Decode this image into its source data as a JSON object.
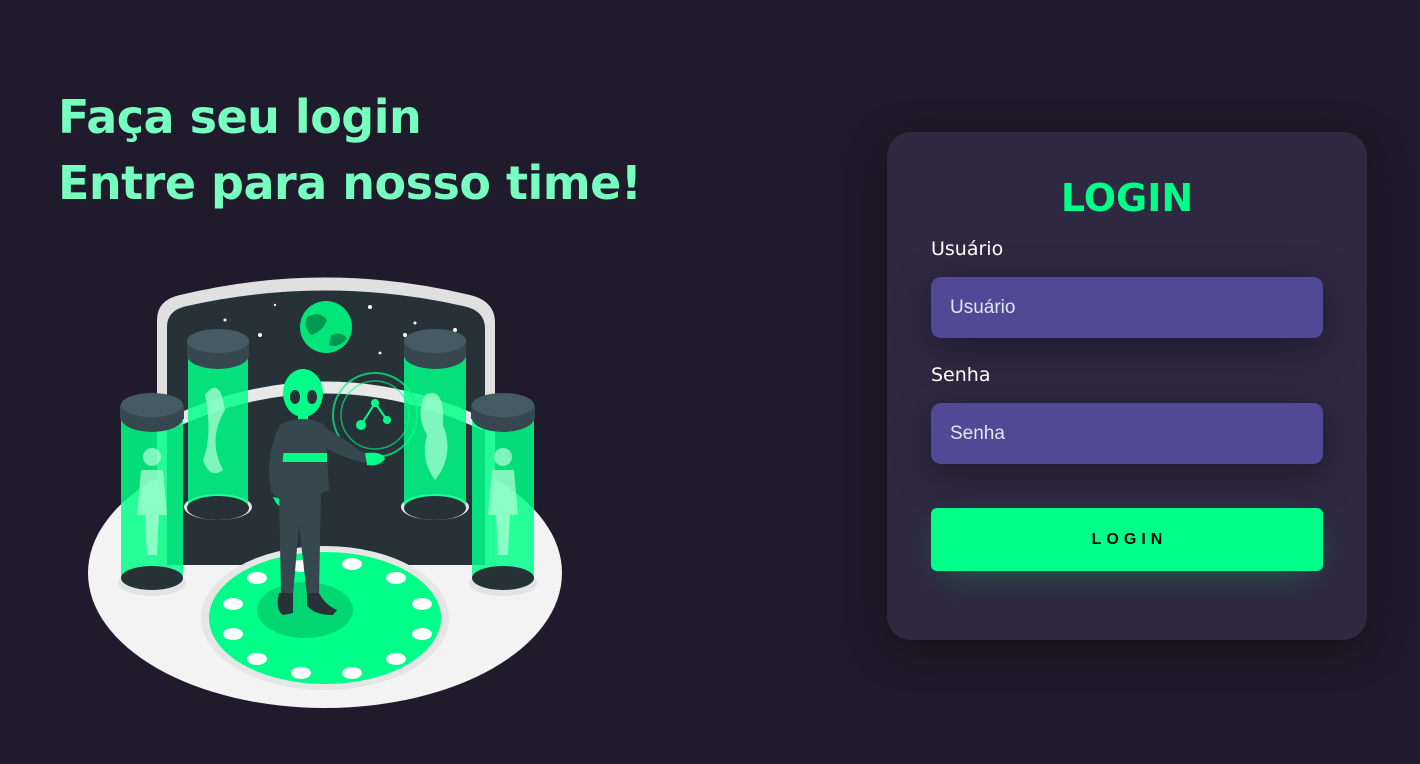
{
  "headline": {
    "line1": "Faça seu login",
    "line2": "Entre para nosso time!"
  },
  "illustration": {
    "description_icon": "alien-lab-illustration-icon"
  },
  "login_card": {
    "title": "LOGIN",
    "username": {
      "label": "Usuário",
      "placeholder": "Usuário",
      "value": ""
    },
    "password": {
      "label": "Senha",
      "placeholder": "Senha",
      "value": ""
    },
    "submit_label": "LOGIN"
  },
  "colors": {
    "background": "#201b2c",
    "card": "#2f2841",
    "accent": "#00ff88",
    "headline": "#77ffc0",
    "input": "#514896"
  }
}
